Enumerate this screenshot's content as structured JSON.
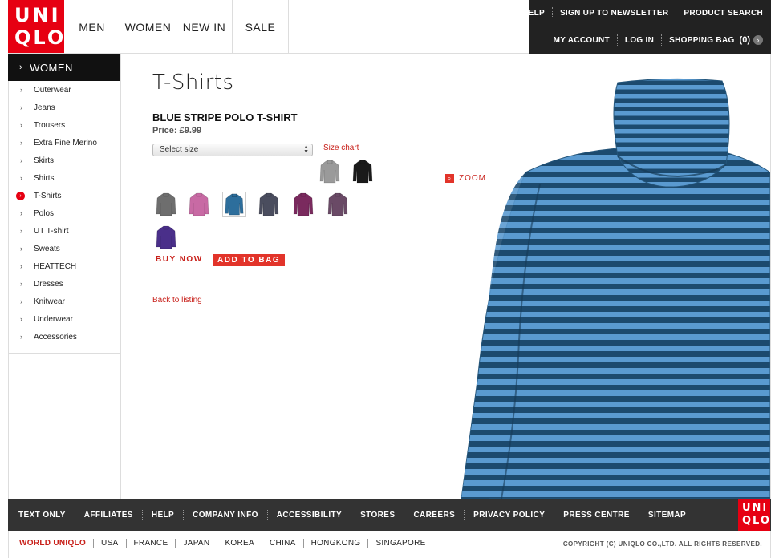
{
  "brand": {
    "logo_line1": "UNI",
    "logo_line2": "QLO"
  },
  "main_nav": [
    "MEN",
    "WOMEN",
    "NEW IN",
    "SALE"
  ],
  "utility": {
    "top": [
      "HELP",
      "SIGN UP TO NEWSLETTER",
      "PRODUCT SEARCH"
    ],
    "bottom": [
      "MY ACCOUNT",
      "LOG IN",
      "SHOPPING BAG"
    ],
    "bag_count": "(0)",
    "bag_arrow": "›"
  },
  "sidebar": {
    "title": "WOMEN",
    "chevron": "›",
    "items": [
      {
        "label": "Outerwear",
        "active": false
      },
      {
        "label": "Jeans",
        "active": false
      },
      {
        "label": "Trousers",
        "active": false
      },
      {
        "label": "Extra Fine Merino",
        "active": false
      },
      {
        "label": "Skirts",
        "active": false
      },
      {
        "label": "Shirts",
        "active": false
      },
      {
        "label": "T-Shirts",
        "active": true
      },
      {
        "label": "Polos",
        "active": false
      },
      {
        "label": "UT T-shirt",
        "active": false
      },
      {
        "label": "Sweats",
        "active": false
      },
      {
        "label": "HEATTECH",
        "active": false
      },
      {
        "label": "Dresses",
        "active": false
      },
      {
        "label": "Knitwear",
        "active": false
      },
      {
        "label": "Underwear",
        "active": false
      },
      {
        "label": "Accessories",
        "active": false
      }
    ]
  },
  "product": {
    "category_title": "T-Shirts",
    "name": "BLUE STRIPE POLO T-SHIRT",
    "price": "Price: £9.99",
    "size_placeholder": "Select size",
    "size_chart_label": "Size chart",
    "zoom_label": "ZOOM",
    "buy_now_label": "BUY NOW",
    "add_to_bag_label": "ADD TO BAG",
    "back_label": "Back to listing",
    "swatches": [
      {
        "name": "grey-stripe",
        "color": "#9a9a9a",
        "selected": false
      },
      {
        "name": "black",
        "color": "#1a1a1a",
        "selected": false
      },
      {
        "name": "charcoal",
        "color": "#6e6e6e",
        "selected": false
      },
      {
        "name": "pink",
        "color": "#c86aa4",
        "selected": false
      },
      {
        "name": "blue",
        "color": "#2d6e9c",
        "selected": true
      },
      {
        "name": "navy-grey",
        "color": "#4a4d5e",
        "selected": false
      },
      {
        "name": "plum",
        "color": "#7a2a5e",
        "selected": false
      },
      {
        "name": "mauve",
        "color": "#6a4a66",
        "selected": false
      },
      {
        "name": "purple",
        "color": "#4a2f8a",
        "selected": false
      }
    ],
    "image_colors": {
      "light_stripe": "#5a9ad0",
      "dark_stripe": "#1c4a6e"
    }
  },
  "footer": {
    "links": [
      "TEXT ONLY",
      "AFFILIATES",
      "HELP",
      "COMPANY INFO",
      "ACCESSIBILITY",
      "STORES",
      "CAREERS",
      "PRIVACY POLICY",
      "PRESS CENTRE",
      "SITEMAP"
    ],
    "world_title": "WORLD UNIQLO",
    "countries": [
      "USA",
      "FRANCE",
      "JAPAN",
      "KOREA",
      "CHINA",
      "HONGKONG",
      "SINGAPORE"
    ],
    "copyright": "COPYRIGHT (C) UNIQLO CO.,LTD. ALL RIGHTS RESERVED."
  },
  "colors": {
    "brand_red": "#e60012",
    "link_red": "#c8201a",
    "dark_bar": "#222222"
  }
}
